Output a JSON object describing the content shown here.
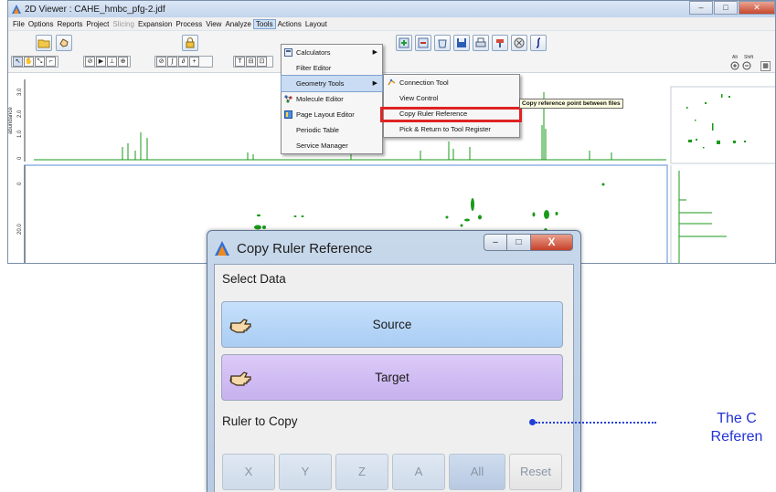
{
  "viewer": {
    "title": "2D Viewer : CAHE_hmbc_pfg-2.jdf",
    "window_controls": {
      "minimize": "–",
      "maximize": "□",
      "close": "✕"
    },
    "menus": [
      {
        "label": "File",
        "state": "normal"
      },
      {
        "label": "Options",
        "state": "normal"
      },
      {
        "label": "Reports",
        "state": "normal"
      },
      {
        "label": "Project",
        "state": "normal"
      },
      {
        "label": "Slicing",
        "state": "disabled"
      },
      {
        "label": "Expansion",
        "state": "normal"
      },
      {
        "label": "Process",
        "state": "normal"
      },
      {
        "label": "View",
        "state": "normal"
      },
      {
        "label": "Analyze",
        "state": "normal"
      },
      {
        "label": "Tools",
        "state": "active"
      },
      {
        "label": "Actions",
        "state": "normal"
      },
      {
        "label": "Layout",
        "state": "normal"
      }
    ],
    "toolbar_small_labels": [
      "T",
      "⊟",
      "⊡",
      "+",
      "∫",
      "⊘"
    ],
    "right_toolbar_labels": {
      "alt": "Alt",
      "shift": "Shift"
    },
    "axis": {
      "ylabel": "abundance",
      "top_ticks": [
        "3.0",
        "2.0",
        "1.0",
        "0"
      ],
      "left_ticks": [
        "0",
        "20.0"
      ]
    }
  },
  "tools_menu": {
    "items": [
      {
        "label": "Calculators",
        "icon": "calculator-icon",
        "submenu": true,
        "highlighted": false
      },
      {
        "label": "Filter Editor",
        "icon": "",
        "submenu": false,
        "highlighted": false
      },
      {
        "label": "Geometry Tools",
        "icon": "",
        "submenu": true,
        "highlighted": true
      },
      {
        "label": "Molecule Editor",
        "icon": "molecule-icon",
        "submenu": false,
        "highlighted": false
      },
      {
        "label": "Page Layout Editor",
        "icon": "page-layout-icon",
        "submenu": false,
        "highlighted": false
      },
      {
        "label": "Periodic Table",
        "icon": "",
        "submenu": false,
        "highlighted": false
      },
      {
        "label": "Service Manager",
        "icon": "",
        "submenu": false,
        "highlighted": false
      }
    ]
  },
  "geometry_menu": {
    "items": [
      {
        "label": "Connection Tool",
        "icon": "connection-icon"
      },
      {
        "label": "View Control",
        "icon": ""
      },
      {
        "label": "Copy Ruler Reference",
        "icon": ""
      },
      {
        "label": "Pick & Return to Tool Register",
        "icon": ""
      }
    ]
  },
  "tooltip": "Copy reference point between files",
  "dialog": {
    "title": "Copy Ruler Reference",
    "window_controls": {
      "minimize": "–",
      "maximize": "□",
      "close": "X"
    },
    "select_data_label": "Select Data",
    "source_label": "Source",
    "target_label": "Target",
    "ruler_label": "Ruler to Copy",
    "ruler_buttons": [
      "X",
      "Y",
      "Z",
      "A",
      "All",
      "Reset"
    ]
  },
  "callout": {
    "line1": "The C",
    "line2": "Referen"
  },
  "colors": {
    "accent_red": "#e02323",
    "callout_blue": "#2233d4",
    "spectrum_green": "#1a9a1a",
    "source_blue": "#b6d6f8",
    "target_purple": "#d3bff3"
  }
}
